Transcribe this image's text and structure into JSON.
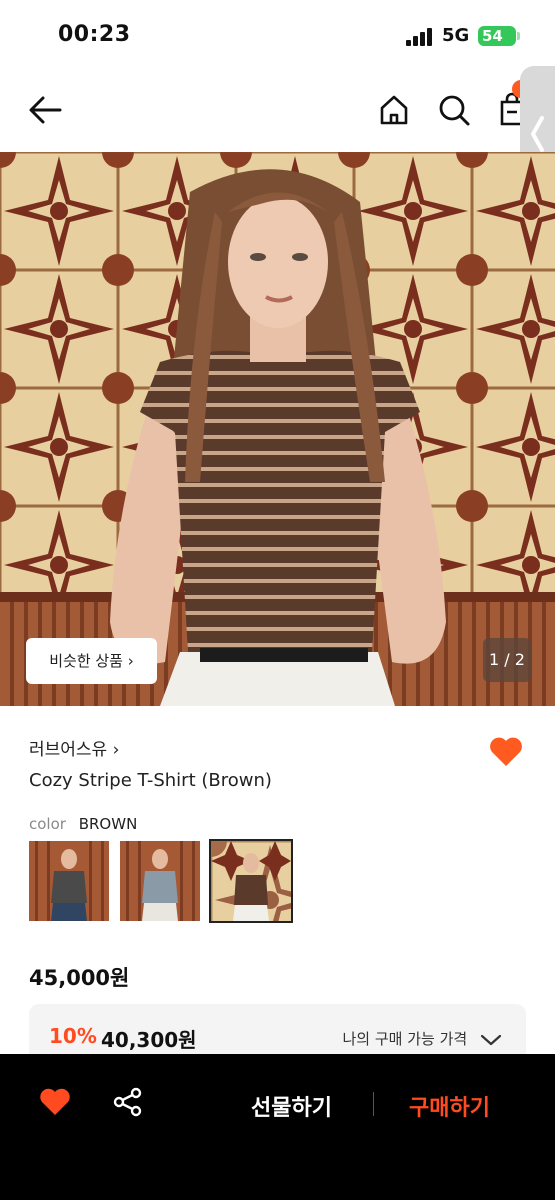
{
  "status": {
    "time": "00:23",
    "network": "5G",
    "battery": "54"
  },
  "product": {
    "brand": "러브어스유 ›",
    "title": "Cozy Stripe T-Shirt (Brown)",
    "color_label": "color",
    "color_value": "BROWN",
    "price": "45,000원",
    "discount_percent": "10%",
    "discount_price": "40,300원",
    "my_price_label": "나의 구매 가능 가격"
  },
  "gallery": {
    "similar_label": "비슷한 상품 ›",
    "counter": "1 / 2"
  },
  "bottom": {
    "gift_label": "선물하기",
    "buy_label": "구매하기"
  },
  "colors": {
    "accent": "#ff4b1f",
    "heart": "#ff5a1f",
    "bar": "#000000"
  },
  "icons": [
    "back-arrow-icon",
    "home-icon",
    "search-icon",
    "cart-icon",
    "chevron-left-icon",
    "heart-icon",
    "share-icon",
    "chevron-down-icon"
  ]
}
